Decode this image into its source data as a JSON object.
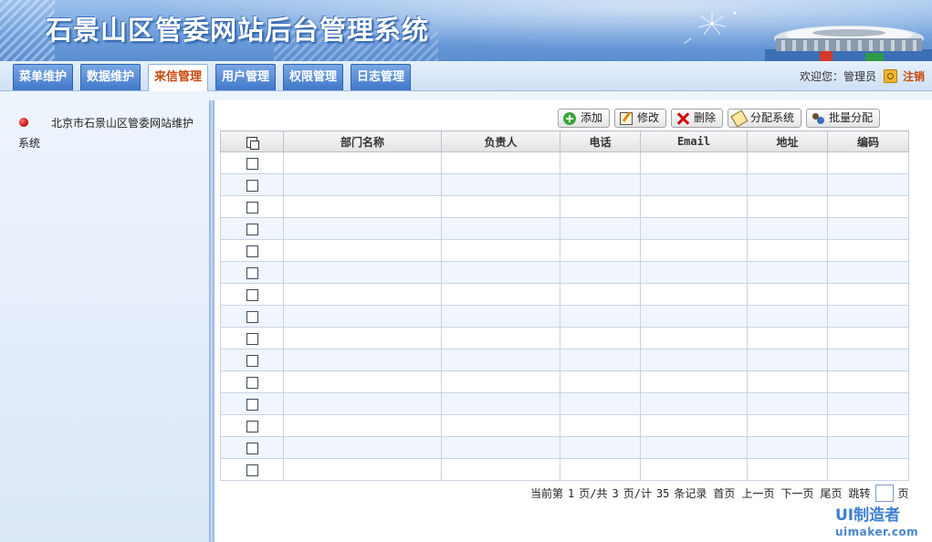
{
  "header": {
    "title": "石景山区管委网站后台管理系统"
  },
  "nav": {
    "tabs": [
      {
        "label": "菜单维护",
        "active": false
      },
      {
        "label": "数据维护",
        "active": false
      },
      {
        "label": "来信管理",
        "active": true
      },
      {
        "label": "用户管理",
        "active": false
      },
      {
        "label": "权限管理",
        "active": false
      },
      {
        "label": "日志管理",
        "active": false
      }
    ],
    "welcome_label": "欢迎您：",
    "user_name": "管理员",
    "logout_label": "注销"
  },
  "sidebar": {
    "items": [
      {
        "label": "北京市石景山区管委网站维护系统"
      }
    ]
  },
  "toolbar": {
    "add_label": "添加",
    "edit_label": "修改",
    "delete_label": "删除",
    "assign_label": "分配系统",
    "batch_assign_label": "批量分配"
  },
  "table": {
    "columns": [
      "部门名称",
      "负责人",
      "电话",
      "Email",
      "地址",
      "编码"
    ],
    "row_count": 15,
    "rows": []
  },
  "pager": {
    "prefix": "当前第",
    "current_page": "1",
    "page_sep": "页/共",
    "total_pages": "3",
    "total_sep": "页/计",
    "total_records": "35",
    "records_suffix": "条记录",
    "first_label": "首页",
    "prev_label": "上一页",
    "next_label": "下一页",
    "last_label": "尾页",
    "jump_label": "跳转",
    "page_suffix": "页"
  },
  "watermark": {
    "line1": "UI制造者",
    "line2": "uimaker.com"
  },
  "colors": {
    "banner": "#6f9fdc",
    "tab_active_text": "#c8480f",
    "row_alt": "#f1f6fd",
    "sidebar_bg": "#dbe8f8"
  }
}
